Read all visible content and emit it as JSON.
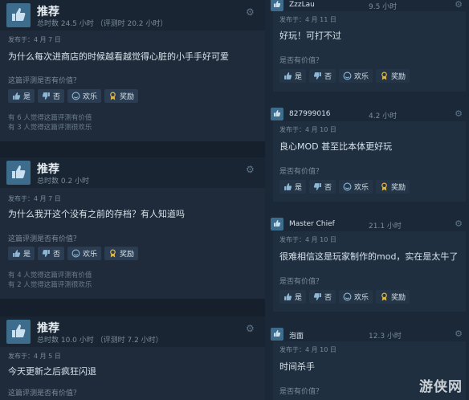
{
  "left_reviews": [
    {
      "recommend": "推荐",
      "hours": "总时数 24.5 小时 （评测时 20.2 小时）",
      "posted": "发布于：4 月 7 日",
      "text": "为什么每次进商店的时候越看越觉得心脏的小手手好可爱",
      "helpful_q": "这篇评测是否有价值？",
      "buttons": {
        "yes": "是",
        "no": "否",
        "funny": "欢乐",
        "award": "奖励"
      },
      "stat1": "有 6 人觉得这篇评测有价值",
      "stat2": "有 3 人觉得这篇评测很欢乐"
    },
    {
      "recommend": "推荐",
      "hours": "总时数 0.2 小时",
      "posted": "发布于：4 月 7 日",
      "text": "为什么我开这个没有之前的存档？有人知道吗",
      "helpful_q": "这篇评测是否有价值？",
      "buttons": {
        "yes": "是",
        "no": "否",
        "funny": "欢乐",
        "award": "奖励"
      },
      "stat1": "有 4 人觉得这篇评测有价值",
      "stat2": "有 2 人觉得这篇评测很欢乐"
    },
    {
      "recommend": "推荐",
      "hours": "总时数 10.0 小时 （评测时 7.2 小时）",
      "posted": "发布于：4 月 5 日",
      "text": "今天更新之后疯狂闪退",
      "helpful_q": "这篇评测是否有价值？"
    }
  ],
  "right_comments": [
    {
      "user": "ZzzLau",
      "hours": "9.5 小时",
      "posted": "发布于：4 月 11 日",
      "text": "好玩！可打不过",
      "helpful_q": "是否有价值？",
      "buttons": {
        "yes": "是",
        "no": "否",
        "funny": "欢乐",
        "award": "奖励"
      }
    },
    {
      "user": "827999016",
      "hours": "4.2 小时",
      "posted": "发布于：4 月 10 日",
      "text": "良心MOD 甚至比本体更好玩",
      "helpful_q": "是否有价值？",
      "buttons": {
        "yes": "是",
        "no": "否",
        "funny": "欢乐",
        "award": "奖励"
      }
    },
    {
      "user": "Master Chief",
      "hours": "21.1 小时",
      "posted": "发布于：4 月 10 日",
      "text": "很难相信这是玩家制作的mod，实在是太牛了",
      "helpful_q": "是否有价值？",
      "buttons": {
        "yes": "是",
        "no": "否",
        "funny": "欢乐",
        "award": "奖励"
      }
    },
    {
      "user": "泡面",
      "hours": "12.3 小时",
      "posted": "发布于：4 月 10 日",
      "text": "时间杀手",
      "helpful_q": "是否有价值？"
    }
  ],
  "watermark": "游侠网"
}
